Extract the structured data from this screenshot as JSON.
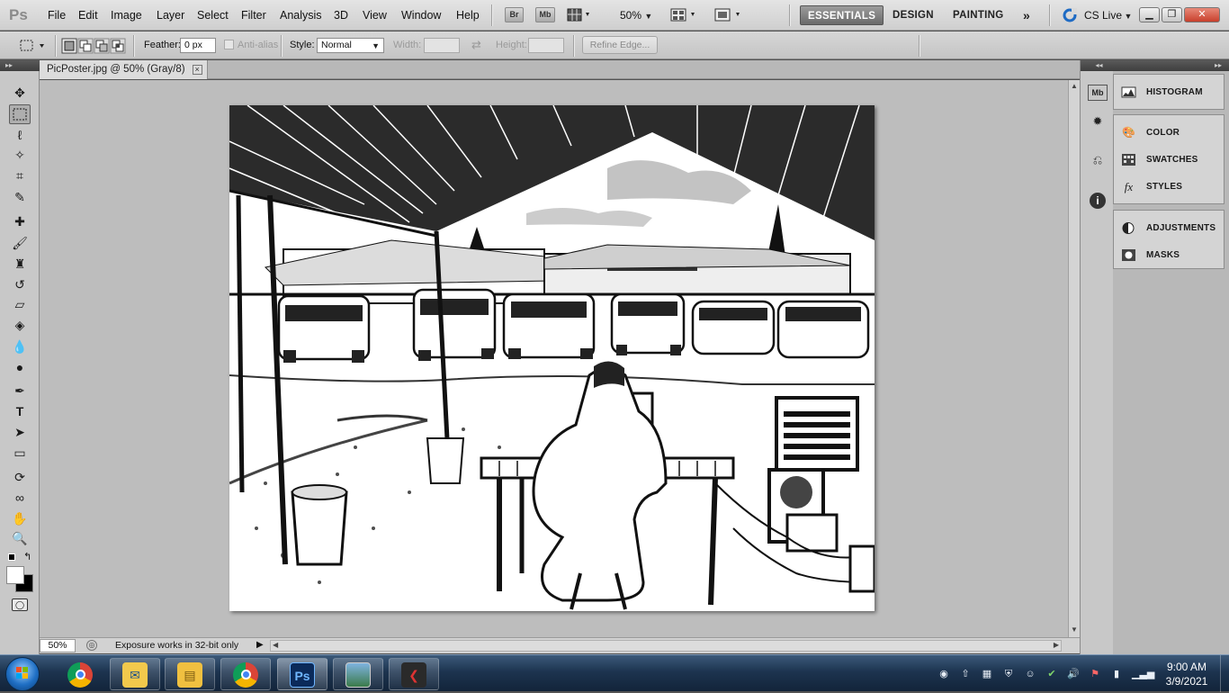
{
  "app": {
    "logo": "Ps"
  },
  "menu": [
    "File",
    "Edit",
    "Image",
    "Layer",
    "Select",
    "Filter",
    "Analysis",
    "3D",
    "View",
    "Window",
    "Help"
  ],
  "menubar_icons": {
    "bridge": "Br",
    "mini_bridge": "Mb",
    "zoom": "50%"
  },
  "workspaces": {
    "essentials": "ESSENTIALS",
    "design": "DESIGN",
    "painting": "PAINTING",
    "more": "»"
  },
  "cslive": "CS Live",
  "options": {
    "feather_label": "Feather:",
    "feather_value": "0 px",
    "antialias_label": "Anti-alias",
    "style_label": "Style:",
    "style_value": "Normal",
    "width_label": "Width:",
    "height_label": "Height:",
    "refine_label": "Refine Edge..."
  },
  "document": {
    "tab_title": "PicPoster.jpg @ 50% (Gray/8)",
    "zoom": "50%",
    "status": "Exposure works in 32-bit only"
  },
  "panels": {
    "group1": [
      {
        "label": "HISTOGRAM",
        "icon": "histogram-icon"
      }
    ],
    "group2": [
      {
        "label": "COLOR",
        "icon": "color-icon"
      },
      {
        "label": "SWATCHES",
        "icon": "swatches-icon"
      },
      {
        "label": "STYLES",
        "icon": "styles-icon"
      }
    ],
    "group3": [
      {
        "label": "ADJUSTMENTS",
        "icon": "adjustments-icon"
      },
      {
        "label": "MASKS",
        "icon": "masks-icon"
      }
    ]
  },
  "side_icons": {
    "mini_bridge": "Mb"
  },
  "tools": [
    "move-tool",
    "marquee-tool",
    "lasso-tool",
    "quick-select-tool",
    "crop-tool",
    "eyedropper-tool",
    "healing-brush-tool",
    "brush-tool",
    "clone-stamp-tool",
    "history-brush-tool",
    "eraser-tool",
    "paint-bucket-tool",
    "blur-tool",
    "dodge-tool",
    "pen-tool",
    "type-tool",
    "path-select-tool",
    "shape-tool",
    "3d-rotate-tool",
    "3d-orbit-tool",
    "hand-tool",
    "zoom-tool"
  ],
  "taskbar": {
    "apps": [
      "chrome",
      "outlook",
      "file-explorer",
      "chrome",
      "photoshop",
      "image-viewer",
      "app"
    ],
    "ps_label": "Ps",
    "time": "9:00 AM",
    "date": "3/9/2021"
  },
  "colors": {
    "ps_blue": "#1f3f7a",
    "essentials_bg": "#7a7a7a",
    "canvas_bg": "#bdbdbd"
  }
}
